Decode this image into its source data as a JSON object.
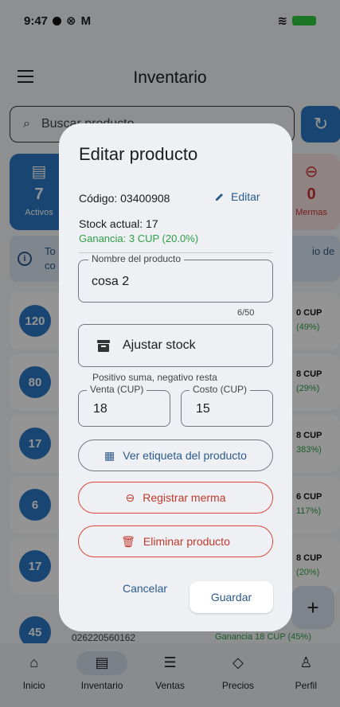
{
  "status_bar": {
    "time": "9:47"
  },
  "app_bar": {
    "title": "Inventario"
  },
  "search": {
    "placeholder": "Buscar producto"
  },
  "stats": {
    "left": {
      "value": "7",
      "label": "Activos"
    },
    "right": {
      "value": "0",
      "label": "Mermas"
    }
  },
  "info_banner": {
    "line1_left": "To",
    "line2_left": "co",
    "line1_right": "io de"
  },
  "list_items": [
    {
      "badge": "120",
      "price": "0 CUP",
      "gain": "(49%)"
    },
    {
      "badge": "80",
      "price": "8 CUP",
      "gain": "(29%)"
    },
    {
      "badge": "17",
      "price": "8 CUP",
      "gain": "383%)"
    },
    {
      "badge": "6",
      "price": "6 CUP",
      "gain": "117%)"
    },
    {
      "badge": "17",
      "price": "8 CUP",
      "gain": "(20%)"
    }
  ],
  "partial_item": {
    "badge": "45",
    "code": "026220560162",
    "gain": "Ganancia 18 CUP (45%)"
  },
  "dialog": {
    "title": "Editar producto",
    "code": "Código: 03400908",
    "edit_label": "Editar",
    "stock": "Stock actual: 17",
    "gain": "Ganancia: 3 CUP (20.0%)",
    "name_label": "Nombre del producto",
    "name_value": "cosa 2",
    "name_counter": "6/50",
    "adjust_label": "Ajustar stock",
    "adjust_hint": "Positivo suma, negativo resta",
    "venta_label": "Venta (CUP)",
    "venta_value": "18",
    "costo_label": "Costo (CUP)",
    "costo_value": "15",
    "tag_button": "Ver etiqueta del producto",
    "merma_button": "Registrar merma",
    "delete_button": "Eliminar producto",
    "cancel_button": "Cancelar",
    "save_button": "Guardar"
  },
  "bottom_nav": [
    {
      "label": "Inicio",
      "icon": "home-icon",
      "glyph": "⌂"
    },
    {
      "label": "Inventario",
      "icon": "archive-icon",
      "glyph": "▤"
    },
    {
      "label": "Ventas",
      "icon": "receipt-icon",
      "glyph": "☰"
    },
    {
      "label": "Precios",
      "icon": "tag-icon",
      "glyph": "◇"
    },
    {
      "label": "Perfil",
      "icon": "person-icon",
      "glyph": "♙"
    }
  ],
  "colors": {
    "primary": "#2b78c5",
    "link": "#2b5a8c",
    "danger": "#c0392b",
    "success": "#2e9f46",
    "dialog_bg": "#eef0f4"
  }
}
